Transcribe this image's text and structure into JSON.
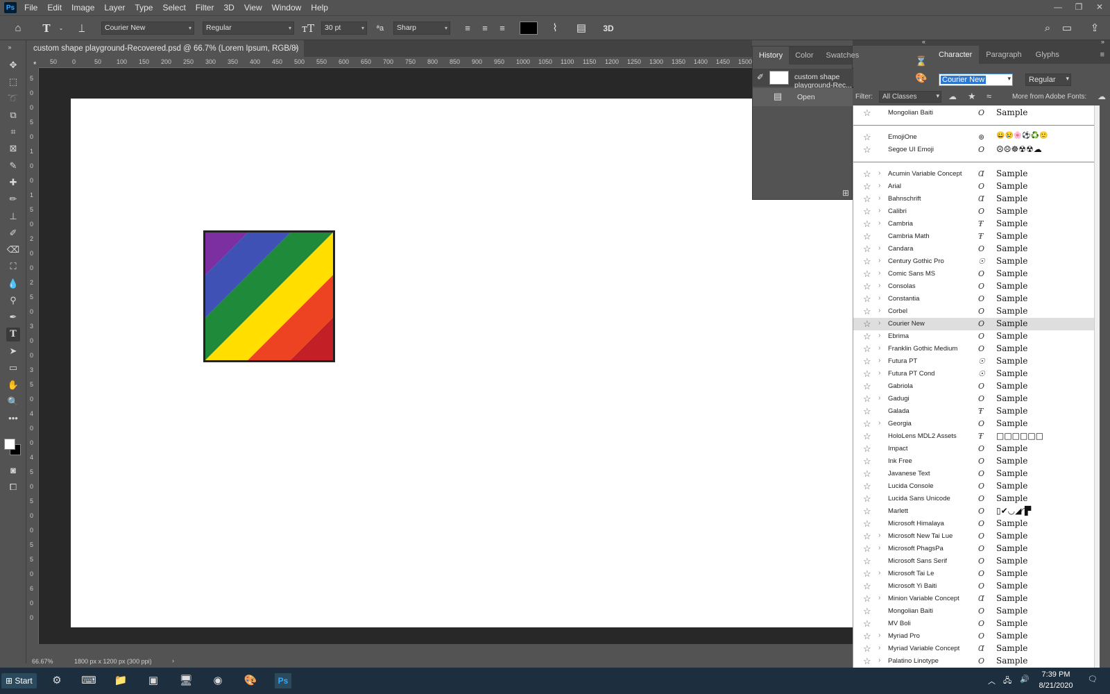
{
  "app": {
    "logo": "Ps"
  },
  "menu": [
    "File",
    "Edit",
    "Image",
    "Layer",
    "Type",
    "Select",
    "Filter",
    "3D",
    "View",
    "Window",
    "Help"
  ],
  "window_controls": [
    "—",
    "❐",
    "✕"
  ],
  "options": {
    "font_family": "Courier New",
    "font_style": "Regular",
    "font_size": "30 pt",
    "antialias": "Sharp",
    "text_color": "#000000",
    "three_d": "3D"
  },
  "document": {
    "tab_title": "custom shape playground-Recovered.psd @ 66.7% (Lorem Ipsum, RGB/8) *",
    "close": "×",
    "stripe_colors": [
      "#7b2fa0",
      "#3f51b5",
      "#1f8b3a",
      "#ffde00",
      "#ee4322",
      "#c21f26"
    ]
  },
  "ruler": {
    "h_labels": [
      "50",
      "0",
      "50",
      "100",
      "150",
      "200",
      "250",
      "300",
      "350",
      "400",
      "450",
      "500",
      "550",
      "600",
      "650",
      "700",
      "750",
      "800",
      "850",
      "900",
      "950",
      "1000",
      "1050",
      "1100",
      "1150",
      "1200",
      "1250",
      "1300",
      "1350",
      "1400",
      "1450",
      "1500"
    ],
    "v_labels": [
      "5",
      "0",
      "0",
      "5",
      "0",
      "1",
      "0",
      "0",
      "1",
      "5",
      "0",
      "2",
      "0",
      "0",
      "2",
      "5",
      "0",
      "3",
      "0",
      "0",
      "3",
      "5",
      "0",
      "4",
      "0",
      "0",
      "4",
      "5",
      "0",
      "5",
      "0",
      "0",
      "5",
      "5",
      "0",
      "6",
      "0",
      "0"
    ]
  },
  "status": {
    "zoom": "66.67%",
    "doc_size": "1800 px x 1200 px (300 ppi)",
    "arrow": "›"
  },
  "history": {
    "tabs": [
      "History",
      "Color",
      "Swatches"
    ],
    "items": [
      {
        "label": "custom shape playground-Rec..."
      },
      {
        "label": "Open"
      }
    ]
  },
  "character": {
    "tabs": [
      "Character",
      "Paragraph",
      "Glyphs"
    ],
    "font_value": "Courier New",
    "style_value": "Regular"
  },
  "filter": {
    "label": "Filter:",
    "value": "All Classes",
    "more": "More from Adobe Fonts:"
  },
  "fonts_top": [
    {
      "name": "Mongolian Baiti",
      "icon": "O",
      "sample": "Sample"
    }
  ],
  "fonts_emoji": [
    {
      "name": "EmojiOne",
      "icon": "⊚",
      "sample": "😀😢🌸⚽♻️🙂"
    },
    {
      "name": "Segoe UI Emoji",
      "icon": "O",
      "sample": "☹☹☸☢☢☁"
    }
  ],
  "fonts": [
    {
      "name": "Acumin Variable Concept",
      "icon": "Ɑ",
      "sample": "Sample",
      "chev": true
    },
    {
      "name": "Arial",
      "icon": "O",
      "sample": "Sample",
      "chev": true
    },
    {
      "name": "Bahnschrift",
      "icon": "Ɑ",
      "sample": "Sample",
      "chev": true
    },
    {
      "name": "Calibri",
      "icon": "O",
      "sample": "Sample",
      "chev": true
    },
    {
      "name": "Cambria",
      "icon": "Ŧ",
      "sample": "Sample",
      "chev": true
    },
    {
      "name": "Cambria Math",
      "icon": "Ŧ",
      "sample": "Sample",
      "chev": false
    },
    {
      "name": "Candara",
      "icon": "O",
      "sample": "Sample",
      "chev": true
    },
    {
      "name": "Century Gothic Pro",
      "icon": "☉",
      "sample": "Sample",
      "chev": true
    },
    {
      "name": "Comic Sans MS",
      "icon": "O",
      "sample": "Sample",
      "chev": true
    },
    {
      "name": "Consolas",
      "icon": "O",
      "sample": "Sample",
      "chev": true
    },
    {
      "name": "Constantia",
      "icon": "O",
      "sample": "Sample",
      "chev": true
    },
    {
      "name": "Corbel",
      "icon": "O",
      "sample": "Sample",
      "chev": true
    },
    {
      "name": "Courier New",
      "icon": "O",
      "sample": "Sample",
      "chev": true,
      "selected": true
    },
    {
      "name": "Ebrima",
      "icon": "O",
      "sample": "Sample",
      "chev": true
    },
    {
      "name": "Franklin Gothic Medium",
      "icon": "O",
      "sample": "Sample",
      "chev": true
    },
    {
      "name": "Futura PT",
      "icon": "☉",
      "sample": "Sample",
      "chev": true
    },
    {
      "name": "Futura PT Cond",
      "icon": "☉",
      "sample": "Sample",
      "chev": true
    },
    {
      "name": "Gabriola",
      "icon": "O",
      "sample": "Sample",
      "chev": false
    },
    {
      "name": "Gadugi",
      "icon": "O",
      "sample": "Sample",
      "chev": true
    },
    {
      "name": "Galada",
      "icon": "Ŧ",
      "sample": "Sample",
      "chev": false
    },
    {
      "name": "Georgia",
      "icon": "O",
      "sample": "Sample",
      "chev": true
    },
    {
      "name": "HoloLens MDL2 Assets",
      "icon": "Ŧ",
      "sample": "□□□□□□",
      "chev": false
    },
    {
      "name": "Impact",
      "icon": "O",
      "sample": "Sample",
      "chev": false
    },
    {
      "name": "Ink Free",
      "icon": "O",
      "sample": "Sample",
      "chev": false
    },
    {
      "name": "Javanese Text",
      "icon": "O",
      "sample": "Sample",
      "chev": false
    },
    {
      "name": "Lucida Console",
      "icon": "O",
      "sample": "Sample",
      "chev": false
    },
    {
      "name": "Lucida Sans Unicode",
      "icon": "O",
      "sample": "Sample",
      "chev": false
    },
    {
      "name": "Marlett",
      "icon": "O",
      "sample": "▯✔︎◡◢◜▛",
      "chev": false
    },
    {
      "name": "Microsoft Himalaya",
      "icon": "O",
      "sample": "Sample",
      "chev": false
    },
    {
      "name": "Microsoft New Tai Lue",
      "icon": "O",
      "sample": "Sample",
      "chev": true
    },
    {
      "name": "Microsoft PhagsPa",
      "icon": "O",
      "sample": "Sample",
      "chev": true
    },
    {
      "name": "Microsoft Sans Serif",
      "icon": "O",
      "sample": "Sample",
      "chev": false
    },
    {
      "name": "Microsoft Tai Le",
      "icon": "O",
      "sample": "Sample",
      "chev": true
    },
    {
      "name": "Microsoft Yi Baiti",
      "icon": "O",
      "sample": "Sample",
      "chev": false
    },
    {
      "name": "Minion Variable Concept",
      "icon": "Ɑ",
      "sample": "Sample",
      "chev": true
    },
    {
      "name": "Mongolian Baiti",
      "icon": "O",
      "sample": "Sample",
      "chev": false
    },
    {
      "name": "MV Boli",
      "icon": "O",
      "sample": "Sample",
      "chev": false
    },
    {
      "name": "Myriad Pro",
      "icon": "O",
      "sample": "Sample",
      "chev": true
    },
    {
      "name": "Myriad Variable Concept",
      "icon": "Ɑ",
      "sample": "Sample",
      "chev": true
    },
    {
      "name": "Palatino Linotype",
      "icon": "O",
      "sample": "Sample",
      "chev": true
    }
  ],
  "taskbar": {
    "start": "Start",
    "time": "7:39 PM",
    "date": "8/21/2020"
  }
}
